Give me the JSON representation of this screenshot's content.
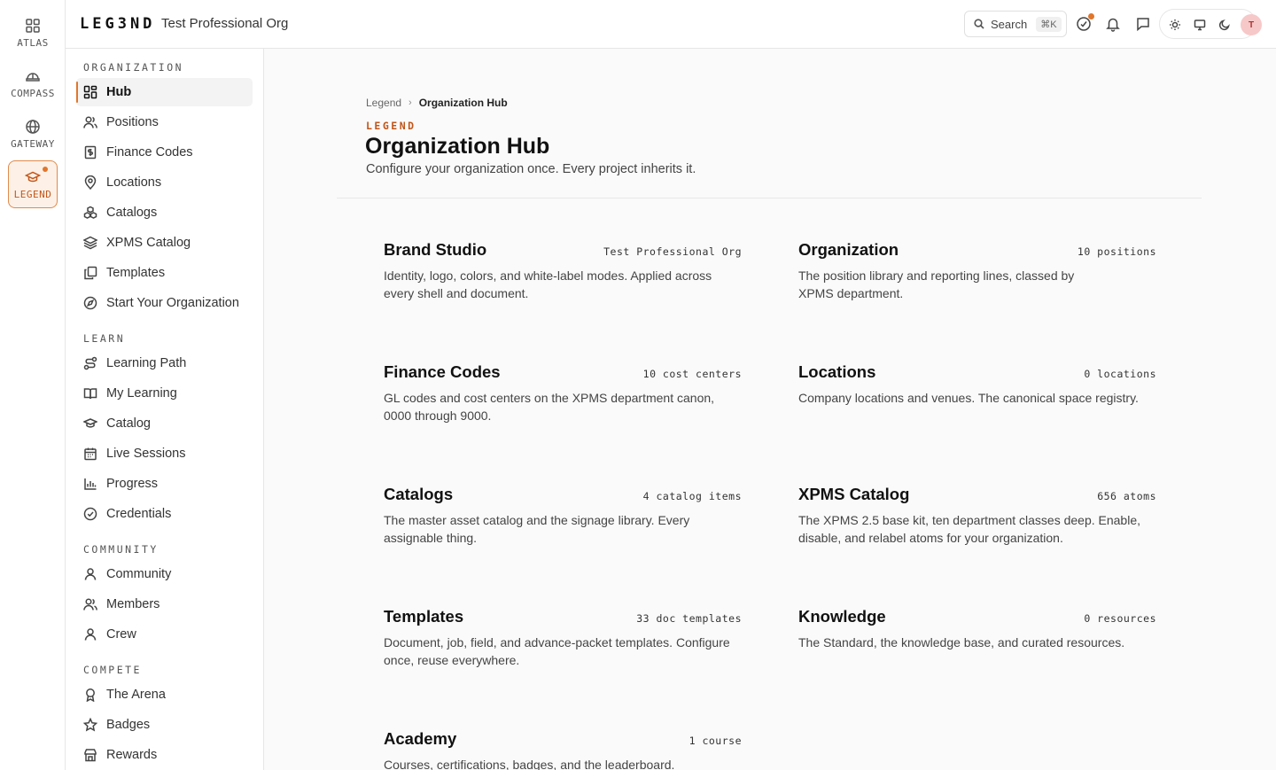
{
  "rail": [
    {
      "label": "ATLAS",
      "icon": "grid-icon"
    },
    {
      "label": "COMPASS",
      "icon": "helmet-icon"
    },
    {
      "label": "GATEWAY",
      "icon": "globe-icon"
    },
    {
      "label": "LEGEND",
      "icon": "graduation-cap-icon",
      "active": true
    }
  ],
  "header": {
    "brand": "LEG3ND",
    "org_name": "Test Professional Org",
    "search_label": "Search",
    "search_shortcut": "⌘K"
  },
  "sidebar": {
    "organization": {
      "title": "ORGANIZATION",
      "items": [
        "Hub",
        "Positions",
        "Finance Codes",
        "Locations",
        "Catalogs",
        "XPMS Catalog",
        "Templates",
        "Start Your Organization"
      ]
    },
    "learn": {
      "title": "LEARN",
      "items": [
        "Learning Path",
        "My Learning",
        "Catalog",
        "Live Sessions",
        "Progress",
        "Credentials"
      ]
    },
    "community": {
      "title": "COMMUNITY",
      "items": [
        "Community",
        "Members",
        "Crew"
      ]
    },
    "compete": {
      "title": "COMPETE",
      "items": [
        "The Arena",
        "Badges",
        "Rewards"
      ]
    }
  },
  "main": {
    "breadcrumb": [
      "Legend",
      "Organization Hub"
    ],
    "eyebrow": "LEGEND",
    "title": "Organization Hub",
    "subtitle": "Configure your organization once. Every project inherits it.",
    "cards": [
      {
        "title": "Brand Studio",
        "meta": "Test Professional Org",
        "desc": "Identity, logo, colors, and white-label modes. Applied across every shell and document."
      },
      {
        "title": "Organization",
        "meta": "10 positions",
        "desc": "The position library and reporting lines, classed by XPMS department."
      },
      {
        "title": "Finance Codes",
        "meta": "10 cost centers",
        "desc": "GL codes and cost centers on the XPMS department canon, 0000 through 9000."
      },
      {
        "title": "Locations",
        "meta": "0 locations",
        "desc": "Company locations and venues. The canonical space registry."
      },
      {
        "title": "Catalogs",
        "meta": "4 catalog items",
        "desc": "The master asset catalog and the signage library. Every assignable thing."
      },
      {
        "title": "XPMS Catalog",
        "meta": "656 atoms",
        "desc": "The XPMS 2.5 base kit, ten department classes deep. Enable, disable, and relabel atoms for your organization."
      },
      {
        "title": "Templates",
        "meta": "33 doc templates",
        "desc": "Document, job, field, and advance-packet templates. Configure once, reuse everywhere."
      },
      {
        "title": "Knowledge",
        "meta": "0 resources",
        "desc": "The Standard, the knowledge base, and curated resources."
      },
      {
        "title": "Academy",
        "meta": "1 course",
        "desc": "Courses, certifications, badges, and the leaderboard."
      }
    ]
  }
}
